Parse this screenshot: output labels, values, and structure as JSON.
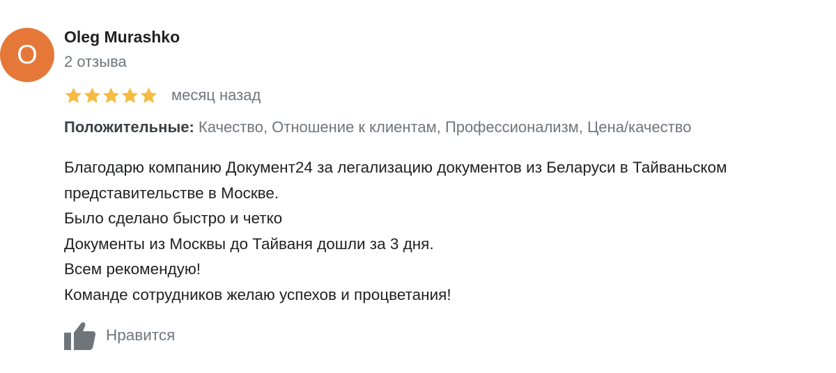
{
  "review": {
    "author": {
      "initial": "O",
      "avatar_color": "#e57839",
      "name": "Oleg Murashko",
      "review_count": "2 отзыва"
    },
    "rating": {
      "stars": 5,
      "max": 5,
      "star_color": "#f6bb42"
    },
    "date": "месяц назад",
    "attributes": {
      "label": "Положительные:",
      "values": " Качество, Отношение к клиентам, Профессионализм, Цена/качество"
    },
    "text_lines": [
      "Благодарю компанию Документ24 за легализацию документов из Беларуси в Тайваньском",
      "представительстве в Москве.",
      "Было сделано быстро и четко",
      "Документы из Москвы до Тайваня дошли за 3 дня.",
      "Всем рекомендую!",
      "Команде сотрудников желаю успехов и процветания!"
    ],
    "like": {
      "icon": "thumbs-up-icon",
      "label": "Нравится",
      "icon_color": "#70757a"
    }
  }
}
